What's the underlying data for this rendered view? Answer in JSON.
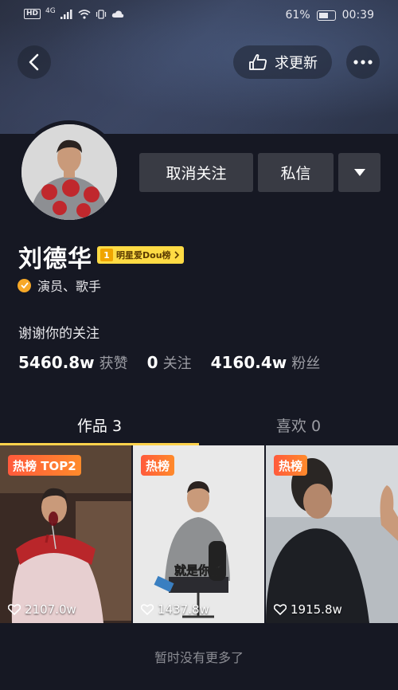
{
  "status_bar": {
    "hd": "HD",
    "network": "4G",
    "battery": "61%",
    "time": "00:39"
  },
  "top_bar": {
    "back_icon": "chevron-left-icon",
    "request_update_label": "求更新",
    "more_icon": "ellipsis-icon"
  },
  "profile": {
    "name": "刘德华",
    "rank_badge_num": "1",
    "rank_badge_label": "明星爱Dou榜",
    "verification": "演员、歌手",
    "bio": "谢谢你的关注",
    "actions": {
      "unfollow": "取消关注",
      "message": "私信",
      "dropdown_icon": "triangle-down-icon"
    },
    "stats": [
      {
        "value": "5460.8w",
        "label": "获赞"
      },
      {
        "value": "0",
        "label": "关注"
      },
      {
        "value": "4160.4w",
        "label": "粉丝"
      }
    ]
  },
  "tabs": [
    {
      "label": "作品 3",
      "active": true
    },
    {
      "label": "喜欢 0",
      "active": false
    }
  ],
  "videos": [
    {
      "badge": "热榜 TOP2",
      "likes": "2107.0w"
    },
    {
      "badge": "热榜",
      "caption": "就是你了",
      "likes": "1437.8w"
    },
    {
      "badge": "热榜",
      "likes": "1915.8w"
    }
  ],
  "footer": "暂时没有更多了",
  "colors": {
    "background": "#161823",
    "accent_yellow": "#fcd24c",
    "button_gray": "#393b44",
    "hot_badge": "#ff5a3c"
  }
}
